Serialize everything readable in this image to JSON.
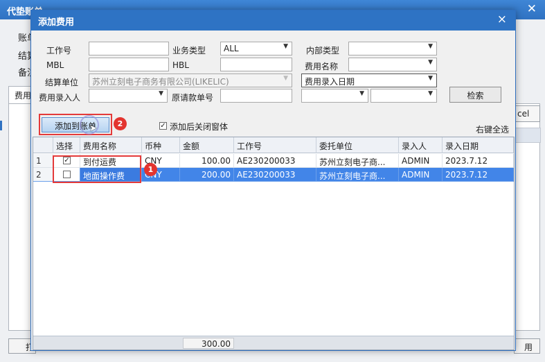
{
  "background": {
    "title": "代垫账单",
    "labels": [
      "账单",
      "结算",
      "备注"
    ],
    "tab_label": "费用",
    "right_button_label": "cel",
    "bottom_buttons": [
      "打",
      "用"
    ]
  },
  "dialog": {
    "title": "添加费用",
    "close_label": "×",
    "filters": {
      "job_no_label": "工作号",
      "job_no_value": "",
      "biz_type_label": "业务类型",
      "biz_type_value": "ALL",
      "internal_type_label": "内部类型",
      "internal_type_value": "",
      "mbl_label": "MBL",
      "mbl_value": "",
      "hbl_label": "HBL",
      "hbl_value": "",
      "fee_name_label": "费用名称",
      "fee_name_value": "",
      "settle_unit_label": "结算单位",
      "settle_unit_value": "苏州立刻电子商务有限公司(LIKELIC)",
      "date_type_value": "费用录入日期",
      "date_from_value": "",
      "entry_user_label": "费用录入人",
      "entry_user_value": "",
      "orig_request_label": "原请款单号",
      "orig_request_value": "",
      "date_a_value": "",
      "date_b_value": "",
      "search_button": "检索"
    },
    "actions": {
      "add_button": "添加到账单",
      "close_after_add_label": "添加后关闭窗体",
      "close_after_add_checked": true,
      "right_select_all": "右键全选",
      "badge_1": "1",
      "badge_2": "2"
    },
    "grid": {
      "columns": [
        "选择",
        "费用名称",
        "币种",
        "金额",
        "工作号",
        "委托单位",
        "录入人",
        "录入日期"
      ],
      "rows": [
        {
          "no": "1",
          "checked": true,
          "fee_name": "到付运费",
          "currency": "CNY",
          "amount": "100.00",
          "job_no": "AE230200033",
          "client": "苏州立刻电子商...",
          "user": "ADMIN",
          "date": "2023.7.12"
        },
        {
          "no": "2",
          "checked": true,
          "fee_name": "地面操作费",
          "currency": "CNY",
          "amount": "200.00",
          "job_no": "AE230200033",
          "client": "苏州立刻电子商...",
          "user": "ADMIN",
          "date": "2023.7.12"
        }
      ],
      "selected_row": 1,
      "total_amount": "300.00"
    }
  },
  "colors": {
    "title_bar": "#2e73c4",
    "selected_row": "#4285e8",
    "annotation_red": "#e43a3a"
  }
}
